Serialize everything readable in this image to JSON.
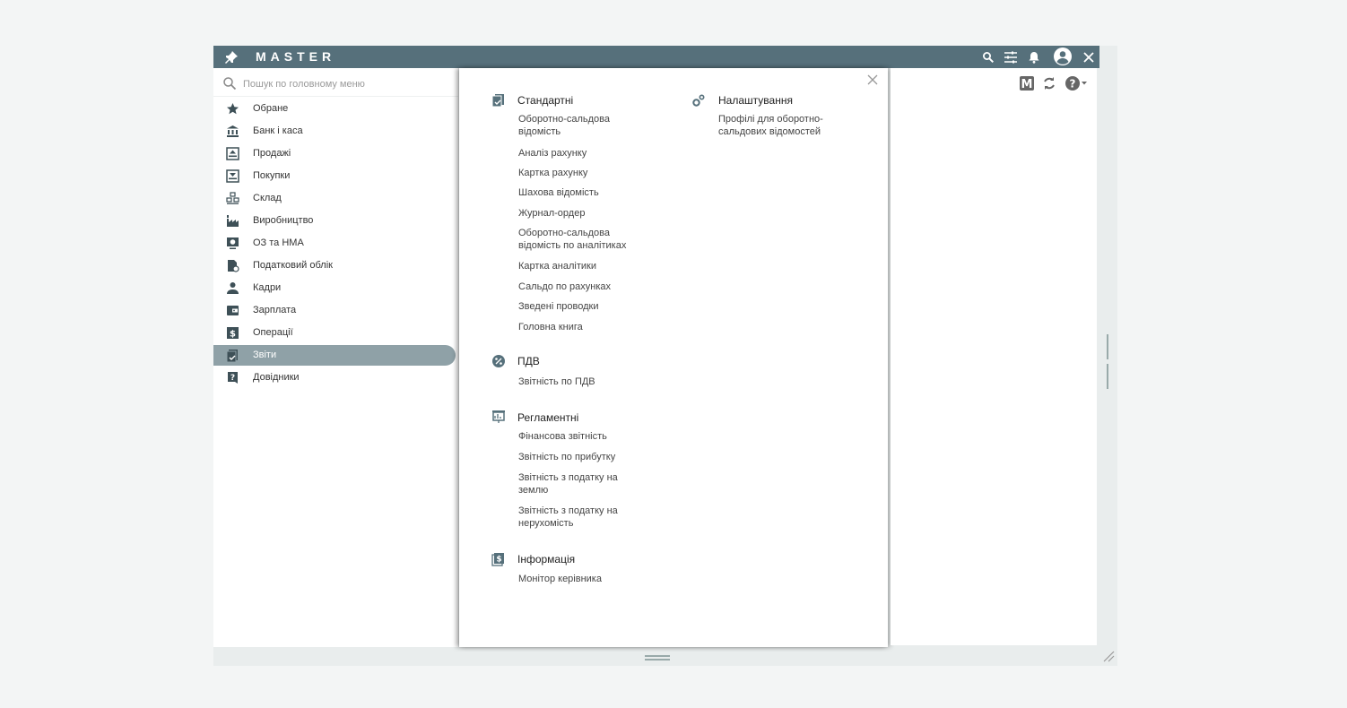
{
  "app": {
    "title": "MASTER"
  },
  "search": {
    "placeholder": "Пошук по головному меню"
  },
  "sidebar": {
    "items": [
      {
        "label": "Обране",
        "icon": "star-icon"
      },
      {
        "label": "Банк і каса",
        "icon": "bank-icon"
      },
      {
        "label": "Продажі",
        "icon": "sales-icon"
      },
      {
        "label": "Покупки",
        "icon": "purchases-icon"
      },
      {
        "label": "Склад",
        "icon": "warehouse-icon"
      },
      {
        "label": "Виробництво",
        "icon": "factory-icon"
      },
      {
        "label": "ОЗ та НМА",
        "icon": "assets-icon"
      },
      {
        "label": "Податковий облік",
        "icon": "tax-icon"
      },
      {
        "label": "Кадри",
        "icon": "person-icon"
      },
      {
        "label": "Зарплата",
        "icon": "wallet-icon"
      },
      {
        "label": "Операції",
        "icon": "dollar-icon"
      },
      {
        "label": "Звіти",
        "icon": "reports-icon",
        "active": true
      },
      {
        "label": "Довідники",
        "icon": "help-book-icon"
      }
    ]
  },
  "panel": {
    "sections": {
      "standard": {
        "title": "Стандартні",
        "links": [
          "Оборотно-сальдова відомість",
          "Аналіз рахунку",
          "Картка рахунку",
          "Шахова відомість",
          "Журнал-ордер",
          "Оборотно-сальдова відомість по аналітиках",
          "Картка аналітики",
          "Сальдо по рахунках",
          "Зведені проводки",
          "Головна книга"
        ]
      },
      "vat": {
        "title": "ПДВ",
        "links": [
          "Звітність по ПДВ"
        ]
      },
      "regulated": {
        "title": "Регламентні",
        "links": [
          "Фінансова звітність",
          "Звітність по прибутку",
          "Звітність з податку на землю",
          "Звітність з податку на нерухомість"
        ]
      },
      "info": {
        "title": "Інформація",
        "links": [
          "Монітор керівника"
        ]
      },
      "settings": {
        "title": "Налаштування",
        "links": [
          "Профілі для оборотно-сальдових відомостей"
        ]
      }
    }
  },
  "colors": {
    "titlebar": "#56707b",
    "active_item": "#8fa1a7",
    "background": "#f3f5f5"
  }
}
